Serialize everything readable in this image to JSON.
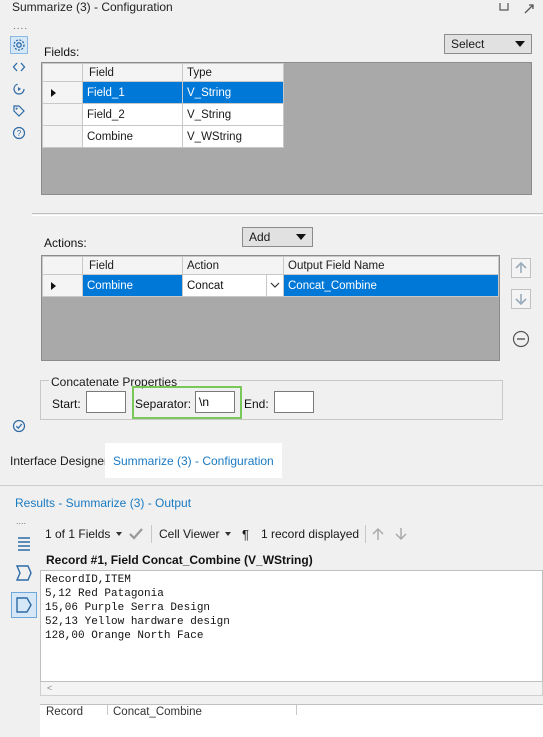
{
  "config": {
    "title": "Summarize (3) - Configuration",
    "fields_label": "Fields:",
    "select_dropdown": "Select",
    "fields_table": {
      "columns": [
        "Field",
        "Type"
      ],
      "rows": [
        {
          "field": "Field_1",
          "type": "V_String",
          "selected": true
        },
        {
          "field": "Field_2",
          "type": "V_String",
          "selected": false
        },
        {
          "field": "Combine",
          "type": "V_WString",
          "selected": false
        }
      ]
    },
    "actions_label": "Actions:",
    "add_dropdown": "Add",
    "actions_table": {
      "columns": [
        "Field",
        "Action",
        "Output Field Name"
      ],
      "rows": [
        {
          "field": "Combine",
          "action": "Concat",
          "output": "Concat_Combine",
          "selected": true
        }
      ]
    },
    "concat_props": {
      "legend": "Concatenate Properties",
      "start_label": "Start:",
      "start_value": "",
      "separator_label": "Separator:",
      "separator_value": "\\n",
      "end_label": "End:",
      "end_value": ""
    },
    "rail_dots": "....",
    "rail_icons": [
      "gear-icon",
      "code-icon",
      "rotate-arrow-icon",
      "tag-icon",
      "help-icon"
    ],
    "check_icon": "check-circle-icon"
  },
  "tabs": [
    {
      "label": "Interface Designer",
      "active": false
    },
    {
      "label": "Summarize (3) - Configuration",
      "active": true
    }
  ],
  "results": {
    "title": "Results - Summarize (3) - Output",
    "fields_dropdown": "1 of 1 Fields",
    "cell_viewer": "Cell Viewer",
    "pilcrow": "¶",
    "records_displayed": "1 record displayed",
    "record_header": "Record #1, Field Concat_Combine (V_WString)",
    "lines": [
      "RecordID,ITEM",
      "5,12 Red Patagonia",
      "15,06 Purple Serra Design",
      "52,13 Yellow hardware design",
      "128,00 Orange North Face"
    ],
    "bottom_columns": [
      "Record",
      "Concat_Combine"
    ],
    "scroll_left": "<"
  },
  "colors": {
    "accent": "#0078d7",
    "link": "#1a7ac2",
    "highlight_box": "#7bc85a",
    "grid_bg": "#a9a9a9"
  }
}
